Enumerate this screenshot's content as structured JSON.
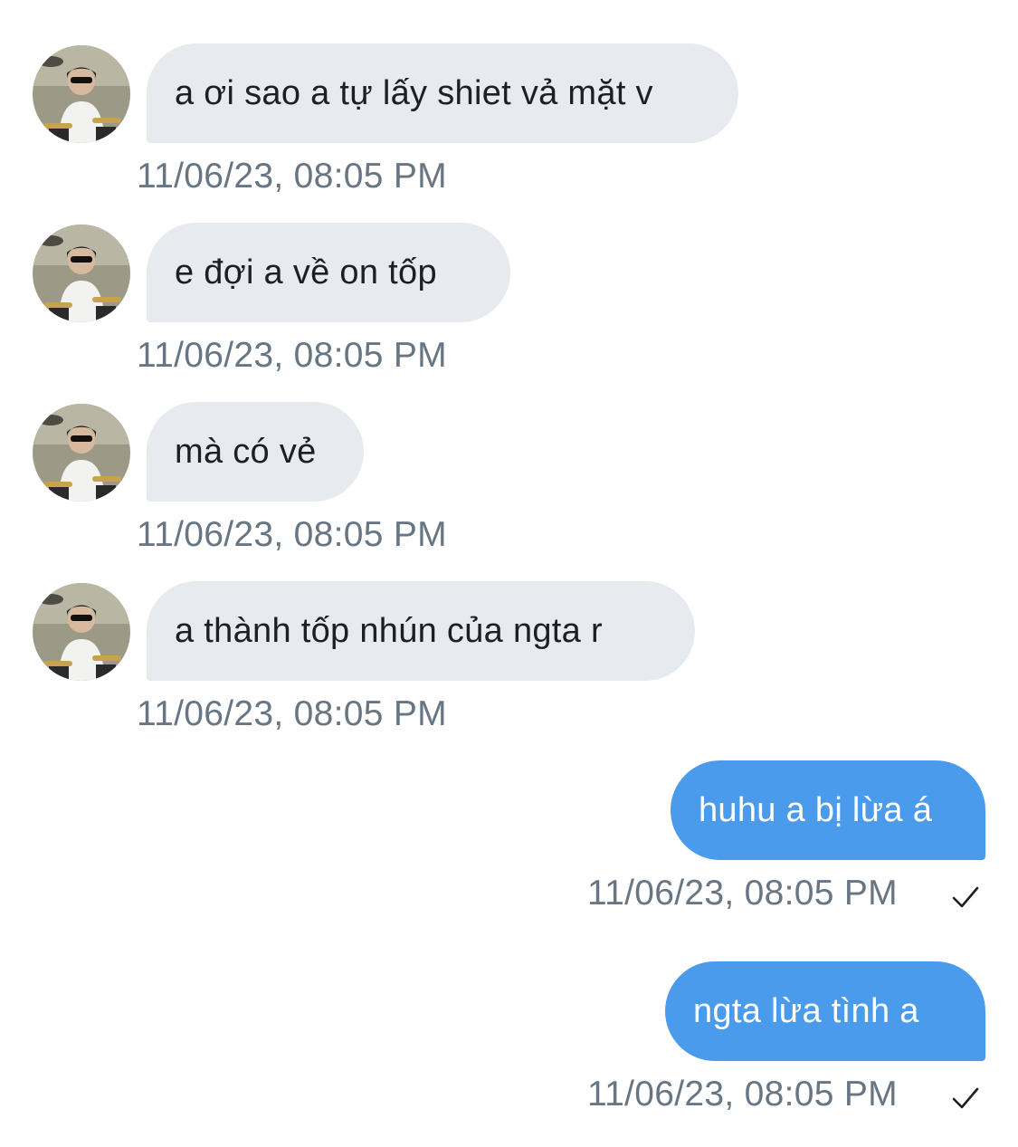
{
  "conversation": {
    "messages": [
      {
        "direction": "incoming",
        "text": "a ơi sao a tự lấy shiet vả mặt v",
        "time": "11/06/23, 08:05 PM"
      },
      {
        "direction": "incoming",
        "text": "e đợi a về on tốp",
        "time": "11/06/23, 08:05 PM"
      },
      {
        "direction": "incoming",
        "text": "mà có vẻ",
        "time": "11/06/23, 08:05 PM"
      },
      {
        "direction": "incoming",
        "text": "a thành tốp nhún của ngta r",
        "time": "11/06/23, 08:05 PM"
      },
      {
        "direction": "outgoing",
        "text": "huhu a bị lừa á",
        "time": "11/06/23, 08:05 PM",
        "status_icon": "checkmark-icon"
      },
      {
        "direction": "outgoing",
        "text": "ngta lừa tình a",
        "time": "11/06/23, 08:05 PM",
        "status_icon": "checkmark-icon"
      }
    ]
  },
  "colors": {
    "incoming_bubble": "#e7eaee",
    "outgoing_bubble": "#4a9bec",
    "timestamp": "#687683",
    "background": "#ffffff"
  },
  "icons": {
    "avatar": "avatar-image",
    "read_receipt": "checkmark-icon"
  }
}
